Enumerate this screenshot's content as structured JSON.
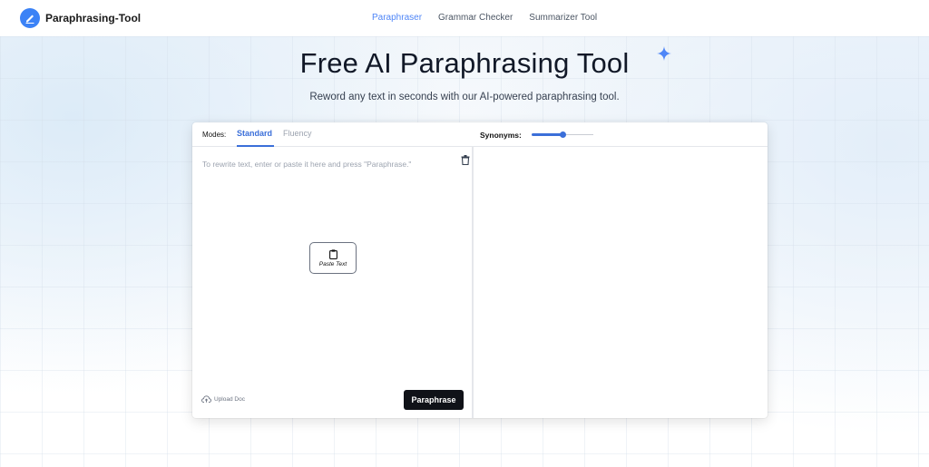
{
  "brand": {
    "name": "Paraphrasing-Tool",
    "accent": "#3b82f6"
  },
  "nav": {
    "items": [
      {
        "label": "Paraphraser",
        "active": true
      },
      {
        "label": "Grammar Checker",
        "active": false
      },
      {
        "label": "Summarizer Tool",
        "active": false
      }
    ]
  },
  "hero": {
    "title": "Free AI Paraphrasing Tool",
    "subtitle": "Reword any text in seconds with our AI-powered paraphrasing tool."
  },
  "tool": {
    "modes_label": "Modes:",
    "tabs": [
      {
        "label": "Standard",
        "active": true
      },
      {
        "label": "Fluency",
        "active": false
      }
    ],
    "synonyms_label": "Synonyms:",
    "synonyms_level": 0.5,
    "input_placeholder": "To rewrite text, enter or paste it here and press \"Paraphrase.\"",
    "paste_label": "Paste Text",
    "upload_label": "Upload Doc",
    "paraphrase_label": "Paraphrase"
  },
  "icons": {
    "logo": "pencil-icon",
    "sparkle": "sparkle-icon",
    "trash": "trash-icon",
    "clipboard": "clipboard-icon",
    "upload": "cloud-upload-icon"
  },
  "colors": {
    "primary": "#3b6fd9",
    "button_dark": "#101218"
  }
}
